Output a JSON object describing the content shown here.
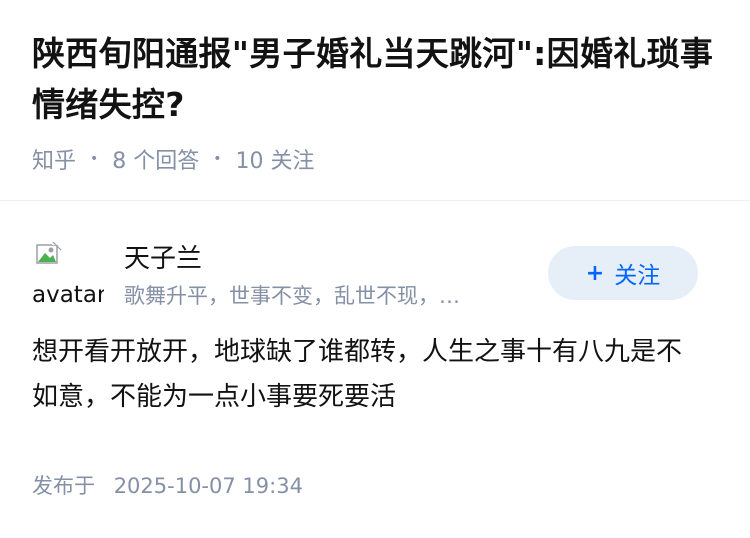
{
  "question": {
    "title": "陕西旬阳通报\"男子婚礼当天跳河\":因婚礼琐事情绪失控?",
    "source": "知乎",
    "answers_count": "8 个回答",
    "followers_count": "10 关注"
  },
  "answer": {
    "author": {
      "avatar_alt": "avatar",
      "name": "天子兰",
      "bio": "歌舞升平，世事不变，乱世不现，…"
    },
    "follow_button": {
      "icon": "plus-icon",
      "label": "关注",
      "color": "#0066ff",
      "background": "#e6eef8"
    },
    "content": "想开看开放开，地球缺了谁都转，人生之事十有八九是不如意，不能为一点小事要死要活",
    "publish_label": "发布于",
    "publish_time": "2025-10-07 19:34"
  },
  "colors": {
    "title": "#121212",
    "meta": "#8590a6",
    "accent": "#0066ff"
  }
}
